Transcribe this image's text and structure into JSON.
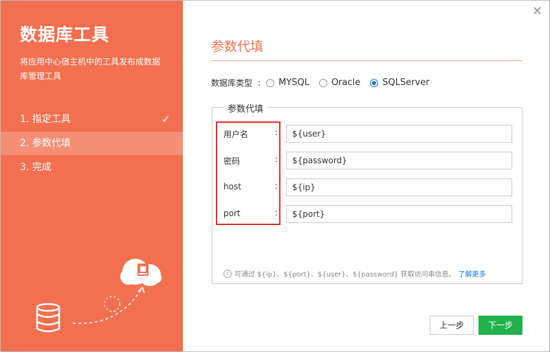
{
  "sidebar": {
    "title": "数据库工具",
    "description": "将应用中心宿主机中的工具发布成数据库管理工具",
    "steps": [
      {
        "label": "1. 指定工具",
        "done": true
      },
      {
        "label": "2. 参数代填",
        "active": true
      },
      {
        "label": "3. 完成"
      }
    ]
  },
  "header": {
    "title": "参数代填"
  },
  "db_type": {
    "label": "数据库类型",
    "colon": ":",
    "options": [
      "MYSQL",
      "Oracle",
      "SQLServer"
    ],
    "selected": "SQLServer"
  },
  "params": {
    "legend": "参数代填",
    "colon": ":",
    "rows": [
      {
        "name": "用户名",
        "value": "${user}"
      },
      {
        "name": "密码",
        "value": "${password}"
      },
      {
        "name": "host",
        "value": "${ip}"
      },
      {
        "name": "port",
        "value": "${port}"
      }
    ]
  },
  "hint": {
    "icon": "i",
    "text": "可通过 ${ip}、${port}、${user}、${password} 获取访问串信息。",
    "link": "了解更多"
  },
  "buttons": {
    "prev": "上一步",
    "next": "下一步"
  },
  "colors": {
    "accent": "#f2704f",
    "next_button": "#22b14c",
    "link": "#1a73e8",
    "highlight_box": "#e0302b"
  }
}
